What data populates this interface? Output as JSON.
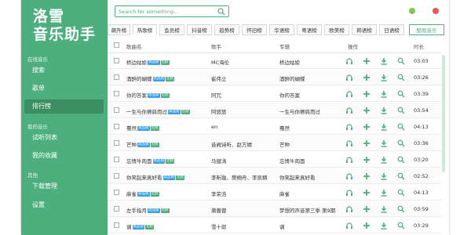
{
  "logo": {
    "line1": "洛雪",
    "line2": "音乐助手"
  },
  "sidebar": {
    "section_online": "在线音乐",
    "items_online": [
      "搜索",
      "歌单",
      "排行榜"
    ],
    "section_mine": "我的音乐",
    "items_mine": [
      "试听列表",
      "我的收藏"
    ],
    "section_other": "其他",
    "items_other": [
      "下载管理",
      "设置"
    ],
    "active": "排行榜"
  },
  "search": {
    "placeholder": "Search for something..."
  },
  "tabs": [
    "飙升榜",
    "热歌榜",
    "会员榜",
    "抖音榜",
    "趋势榜",
    "怀旧榜",
    "华语榜",
    "粤语榜",
    "欧美榜",
    "韩语榜",
    "日语榜"
  ],
  "active_tab": "热歌榜",
  "ranking_source": "酷我音乐",
  "columns": {
    "name": "歌曲名",
    "artist": "歌手",
    "album": "专辑",
    "ops": "操作",
    "duration": "时长"
  },
  "badges": {
    "hq": "高品质",
    "lossless": "无损"
  },
  "rows": [
    {
      "name": "桥边姑娘",
      "hq": true,
      "ll": true,
      "artist": "MC海伦",
      "album": "桥边姑娘",
      "duration": "03:03"
    },
    {
      "name": "酒醉的蝴蝶",
      "hq": true,
      "ll": true,
      "artist": "崔伟立",
      "album": "酒醉的蝴蝶",
      "duration": "03:26"
    },
    {
      "name": "你的答案",
      "hq": true,
      "ll": true,
      "artist": "阿冗",
      "album": "你的答案",
      "duration": "03:39"
    },
    {
      "name": "一生与你擦肩而过",
      "hq": true,
      "ll": true,
      "artist": "阿悠悠",
      "album": "一生与你擦肩而过",
      "duration": "03:54"
    },
    {
      "name": "蓦然",
      "hq": true,
      "ll": true,
      "artist": "en",
      "album": "蓦然",
      "duration": "04:13"
    },
    {
      "name": "芒种",
      "hq": true,
      "ll": true,
      "artist": "音阙诗听、赵方婧",
      "album": "芒种",
      "duration": "03:36"
    },
    {
      "name": "忘情牛肉面",
      "hq": true,
      "ll": true,
      "artist": "马健涛",
      "album": "忘情牛肉面",
      "duration": "03:20"
    },
    {
      "name": "你笑起来真好看",
      "hq": true,
      "ll": true,
      "artist": "李昕融、樊桐舟、李凯稠",
      "album": "你笑起来真好看",
      "duration": "02:52"
    },
    {
      "name": "麻雀",
      "hq": true,
      "ll": true,
      "artist": "李荣浩",
      "album": "麻雀",
      "duration": "04:13"
    },
    {
      "name": "左手指月",
      "hq": true,
      "ll": true,
      "artist": "萧蔷蓉",
      "album": "梦想的声音第三季 第9期",
      "duration": "03:59"
    },
    {
      "name": "谪",
      "hq": true,
      "ll": true,
      "artist": "雪十郎",
      "album": "谪",
      "duration": "03:29"
    }
  ],
  "colors": {
    "accent": "#4caf7d",
    "sidebar_active": "#3b8f63",
    "badge_hq": "#3aa0e8",
    "close": "#e45a57",
    "minimize": "#7ec850"
  }
}
